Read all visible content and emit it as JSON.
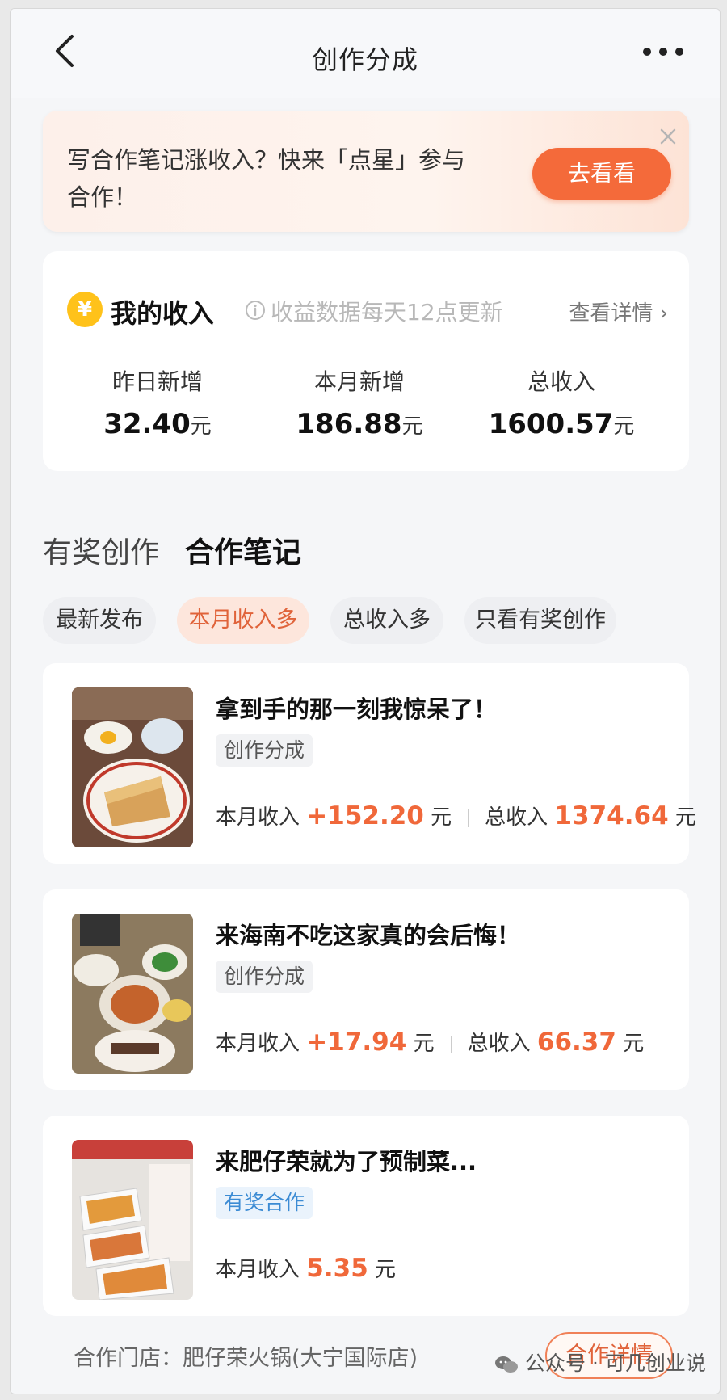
{
  "nav": {
    "title": "创作分成"
  },
  "banner": {
    "text": "写合作笔记涨收入？快来「点星」参与合作！",
    "button_label": "去看看"
  },
  "income": {
    "coin_symbol": "¥",
    "heading": "我的收入",
    "note": "收益数据每天12点更新",
    "detail_link": "查看详情 ›",
    "stats": [
      {
        "label": "昨日新增",
        "value": "32.40",
        "unit": "元"
      },
      {
        "label": "本月新增",
        "value": "186.88",
        "unit": "元"
      },
      {
        "label": "总收入",
        "value": "1600.57",
        "unit": "元"
      }
    ]
  },
  "tabs": [
    {
      "label": "有奖创作",
      "active": false
    },
    {
      "label": "合作笔记",
      "active": true
    }
  ],
  "filters": [
    {
      "label": "最新发布",
      "selected": false
    },
    {
      "label": "本月收入多",
      "selected": true
    },
    {
      "label": "总收入多",
      "selected": false
    },
    {
      "label": "只看有奖创作",
      "selected": false
    }
  ],
  "notes": [
    {
      "title": "拿到手的那一刻我惊呆了！",
      "tag": "创作分成",
      "month_label": "本月收入",
      "month_value": "+152.20",
      "unit": "元",
      "total_label": "总收入",
      "total_value": "1374.64"
    },
    {
      "title": "来海南不吃这家真的会后悔！",
      "tag": "创作分成",
      "month_label": "本月收入",
      "month_value": "+17.94",
      "unit": "元",
      "total_label": "总收入",
      "total_value": "66.37"
    },
    {
      "title": "来肥仔荣就为了预制菜...",
      "tag": "有奖合作",
      "month_label": "本月收入",
      "month_value": "5.35",
      "unit": "元"
    }
  ],
  "store": {
    "text": "合作门店：肥仔荣火锅(大宁国际店)",
    "button_label": "合作详情"
  },
  "watermark": "公众号 · 可几创业说",
  "colors": {
    "accent": "#f46a3a",
    "accent_text": "#f0683a",
    "coin": "#ffc21a",
    "reward_tag": "#3b8bd4"
  }
}
